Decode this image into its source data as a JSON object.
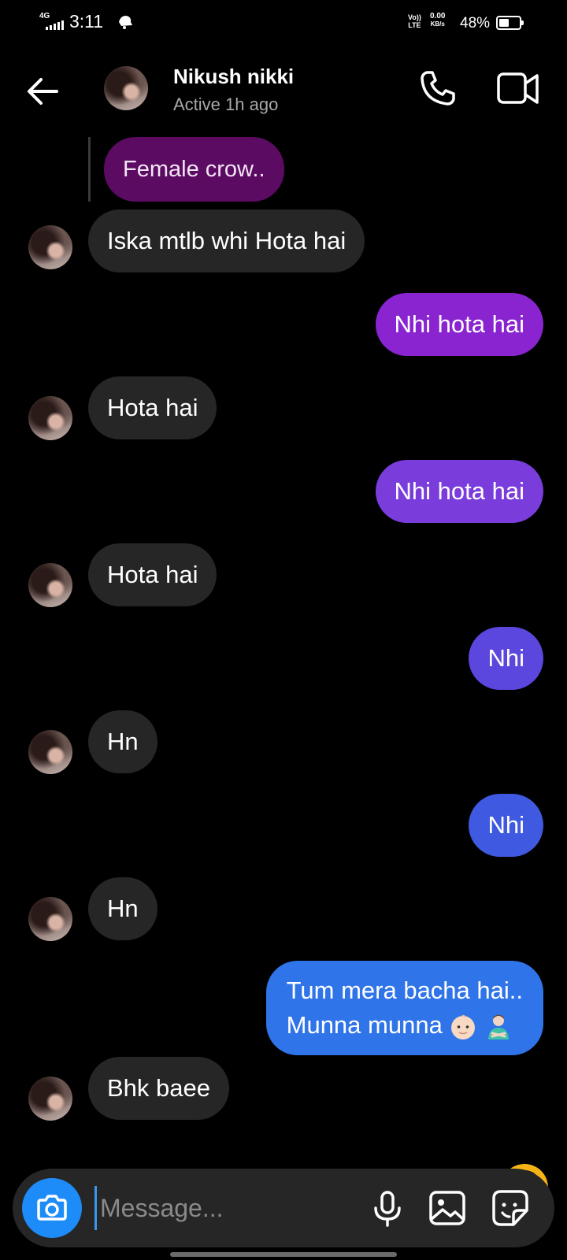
{
  "status_bar": {
    "network": "4G",
    "time": "3:11",
    "volte_top": "Vo))",
    "volte_bottom": "LTE",
    "speed_value": "0.00",
    "speed_unit": "KB/s",
    "battery_pct": "48%",
    "battery_level": 0.48
  },
  "header": {
    "contact_name": "Nikush nikki",
    "contact_status": "Active 1h ago",
    "icons": [
      "back-arrow-icon",
      "phone-icon",
      "video-icon"
    ]
  },
  "conversation": {
    "reply_preview": "Female crow..",
    "messages": [
      {
        "side": "in",
        "text": "Iska mtlb whi Hota hai"
      },
      {
        "side": "out",
        "text": "Nhi hota hai",
        "color": "#8a24d0"
      },
      {
        "side": "in",
        "text": "Hota hai"
      },
      {
        "side": "out",
        "text": "Nhi hota hai",
        "color": "#7a3ddc"
      },
      {
        "side": "in",
        "text": "Hota hai"
      },
      {
        "side": "out",
        "text": "Nhi",
        "color": "#5b47de"
      },
      {
        "side": "in",
        "text": "Hn"
      },
      {
        "side": "out",
        "text": "Nhi",
        "color": "#3f5ae0"
      },
      {
        "side": "in",
        "text": "Hn"
      },
      {
        "side": "out",
        "line1": "Tum mera bacha hai..",
        "line2": "Munna munna",
        "color": "#2f74e8"
      },
      {
        "side": "in",
        "text": "Bhk baee"
      }
    ]
  },
  "composer": {
    "placeholder": "Message...",
    "icons": [
      "camera-icon",
      "microphone-icon",
      "gallery-icon",
      "sticker-icon"
    ]
  },
  "colors": {
    "incoming_bubble": "#262626",
    "reply_bubble": "#5c0b63",
    "camera_button": "#1d8cf8",
    "background": "#000000"
  }
}
